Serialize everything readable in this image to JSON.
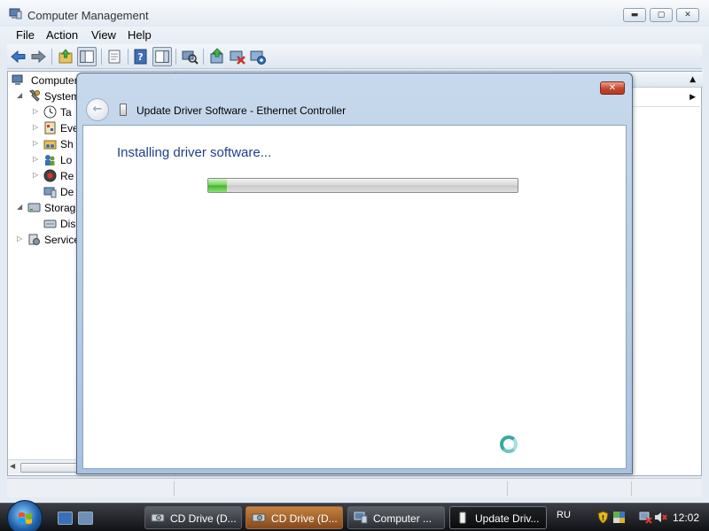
{
  "main_window": {
    "title": "Computer Management",
    "menu": [
      "File",
      "Action",
      "View",
      "Help"
    ],
    "tree": [
      {
        "label": "Computer",
        "icon": "computer-icon"
      },
      {
        "label": "System",
        "icon": "system-tools-icon",
        "expander": "◢"
      },
      {
        "label": "Ta",
        "icon": "clock-icon",
        "expander": "▷"
      },
      {
        "label": "Eve",
        "icon": "event-viewer-icon",
        "expander": "▷"
      },
      {
        "label": "Sh",
        "icon": "shared-folders-icon",
        "expander": "▷"
      },
      {
        "label": "Lo",
        "icon": "local-users-icon",
        "expander": "▷"
      },
      {
        "label": "Re",
        "icon": "reliability-icon",
        "expander": "▷"
      },
      {
        "label": "De",
        "icon": "device-manager-icon"
      },
      {
        "label": "Storag",
        "icon": "storage-icon",
        "expander": "◢"
      },
      {
        "label": "Dis",
        "icon": "disk-management-icon"
      },
      {
        "label": "Service",
        "icon": "services-icon",
        "expander": "▷"
      }
    ]
  },
  "dialog": {
    "title": "Update Driver Software - Ethernet Controller",
    "status_heading": "Installing driver software...",
    "progress_fraction": 0.06,
    "close_label": "✕",
    "back_label": "←"
  },
  "taskbar": {
    "buttons": [
      {
        "label": "CD Drive (D..."
      },
      {
        "label": "CD Drive (D..."
      },
      {
        "label": "Computer ..."
      },
      {
        "label": "Update Driv..."
      }
    ],
    "language": "RU",
    "clock": "12:02"
  },
  "colors": {
    "dialog_heading": "#1e3f8a",
    "progress_green": "#3fb523",
    "busy_spinner": "#36a9a2"
  }
}
